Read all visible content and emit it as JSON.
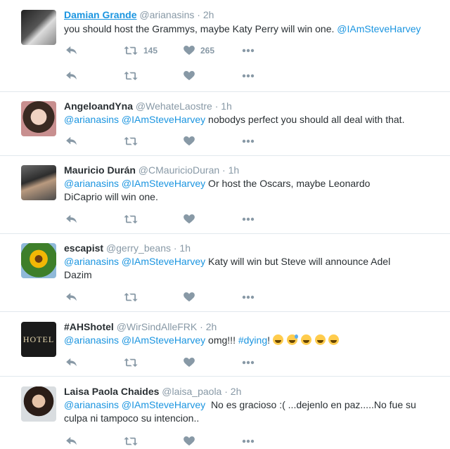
{
  "tweets": [
    {
      "name": "Damian Grande",
      "handle": "@arianasins",
      "time": "· 2h",
      "text_plain": "you should host the Grammys, maybe Katy Perry will win one. ",
      "mention1": "@IAmSteveHarvey",
      "retweets": "145",
      "likes": "265"
    },
    {
      "name": "AngeloandYna",
      "handle": "@WehateLaostre",
      "time": "· 1h",
      "mention1": "@arianasins",
      "mention2": "@IAmSteveHarvey",
      "text_plain": " nobodys perfect you should all deal with that."
    },
    {
      "name": "Mauricio Durán",
      "handle": "@CMauricioDuran",
      "time": "· 1h",
      "mention1": "@arianasins",
      "mention2": "@IAmSteveHarvey",
      "text_plain": " Or host the Oscars, maybe Leonardo DiCaprio will win one."
    },
    {
      "name": "escapist",
      "handle": "@gerry_beans",
      "time": "· 1h",
      "mention1": "@arianasins",
      "mention2": "@IAmSteveHarvey",
      "text_plain": " Katy will win but Steve will announce Adel Dazim"
    },
    {
      "name": "#AHShotel",
      "handle": "@WirSindAlleFRK",
      "time": "· 2h",
      "mention1": "@arianasins",
      "mention2": "@IAmSteveHarvey",
      "text_plain": " omg!!! ",
      "hashtag": "#dying",
      "text_after": "! ",
      "avatar_text": "HOTEL"
    },
    {
      "name": "Laisa Paola Chaides",
      "handle": "@laisa_paola",
      "time": "· 2h",
      "mention1": "@arianasins",
      "mention2": "@IAmSteveHarvey",
      "text_plain": "  No es gracioso :( ...dejenlo en paz.....No fue su culpa ni tampoco su intencion.."
    }
  ],
  "icons": {
    "reply": "reply-icon",
    "retweet": "retweet-icon",
    "like": "heart-icon",
    "more": "more-icon"
  },
  "colors": {
    "link": "#1b95e0",
    "muted": "#8899a6",
    "icon": "#8899a6",
    "text": "#292f33"
  }
}
